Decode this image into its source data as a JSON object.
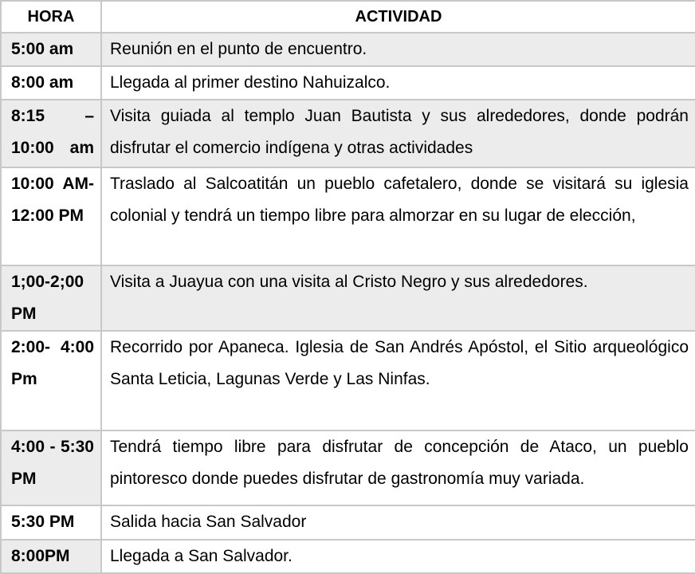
{
  "headers": {
    "hora": "HORA",
    "actividad": "ACTIVIDAD"
  },
  "rows": [
    {
      "hora": "5:00 am",
      "actividad": "Reunión en el punto de encuentro."
    },
    {
      "hora": "8:00 am",
      "actividad": "Llegada al primer destino Nahuizalco."
    },
    {
      "hora": "8:15 – 10:00 am",
      "actividad": "Visita guiada al templo Juan Bautista y sus alrededores, donde podrán disfrutar el comercio indígena y otras actividades"
    },
    {
      "hora": "10:00 AM- 12:00 PM",
      "actividad": "Traslado al Salcoatitán un pueblo cafetalero, donde se visitará su iglesia colonial y tendrá un tiempo libre para almorzar en su lugar de elección,"
    },
    {
      "hora": "1;00-2;00 PM",
      "actividad": "Visita a Juayua con una visita al Cristo Negro y sus alrededores."
    },
    {
      "hora": "2:00- 4:00 Pm",
      "actividad": "Recorrido por Apaneca. Iglesia de San Andrés Apóstol, el Sitio arqueológico Santa Leticia, Lagunas Verde y Las Ninfas."
    },
    {
      "hora": "4:00 - 5:30 PM",
      "actividad": "Tendrá tiempo libre para disfrutar de concepción de Ataco, un pueblo pintoresco donde puedes disfrutar de gastronomía muy variada."
    },
    {
      "hora": "5:30 PM",
      "actividad": "Salida hacia San Salvador"
    },
    {
      "hora": "8:00PM",
      "actividad": "Llegada a San Salvador."
    }
  ]
}
